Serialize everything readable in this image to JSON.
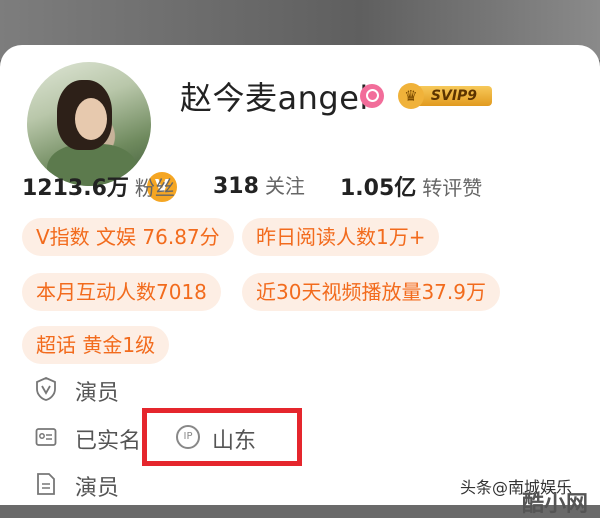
{
  "profile": {
    "name": "赵今麦angel",
    "verified_mark": "V",
    "svip_label": "SVIP9",
    "icons": {
      "verified": "verified-v-icon",
      "pink_badge": "search-circle-icon",
      "svip": "crown-icon"
    }
  },
  "stats": [
    {
      "num": "1213.6万",
      "label": "粉丝"
    },
    {
      "num": "318",
      "label": "关注"
    },
    {
      "num": "1.05亿",
      "label": "转评赞"
    }
  ],
  "tags": [
    "V指数 文娱 76.87分",
    "昨日阅读人数1万+",
    "本月互动人数7018",
    "近30天视频播放量37.9万",
    "超话 黄金1级"
  ],
  "info": [
    {
      "icon": "v-shield-icon",
      "text": "演员"
    },
    {
      "icon": "id-card-icon",
      "text": "已实名"
    },
    {
      "icon": "document-icon",
      "text": "演员"
    }
  ],
  "ip": {
    "icon_text": "IP",
    "location": "山东"
  },
  "watermark": {
    "text": "头条@南城娱乐",
    "corner": "酷小网"
  },
  "colors": {
    "accent": "#f26b1d",
    "pill_bg": "#fdeee4",
    "highlight_box": "#e5262d",
    "vbadge": "#f5a623"
  }
}
